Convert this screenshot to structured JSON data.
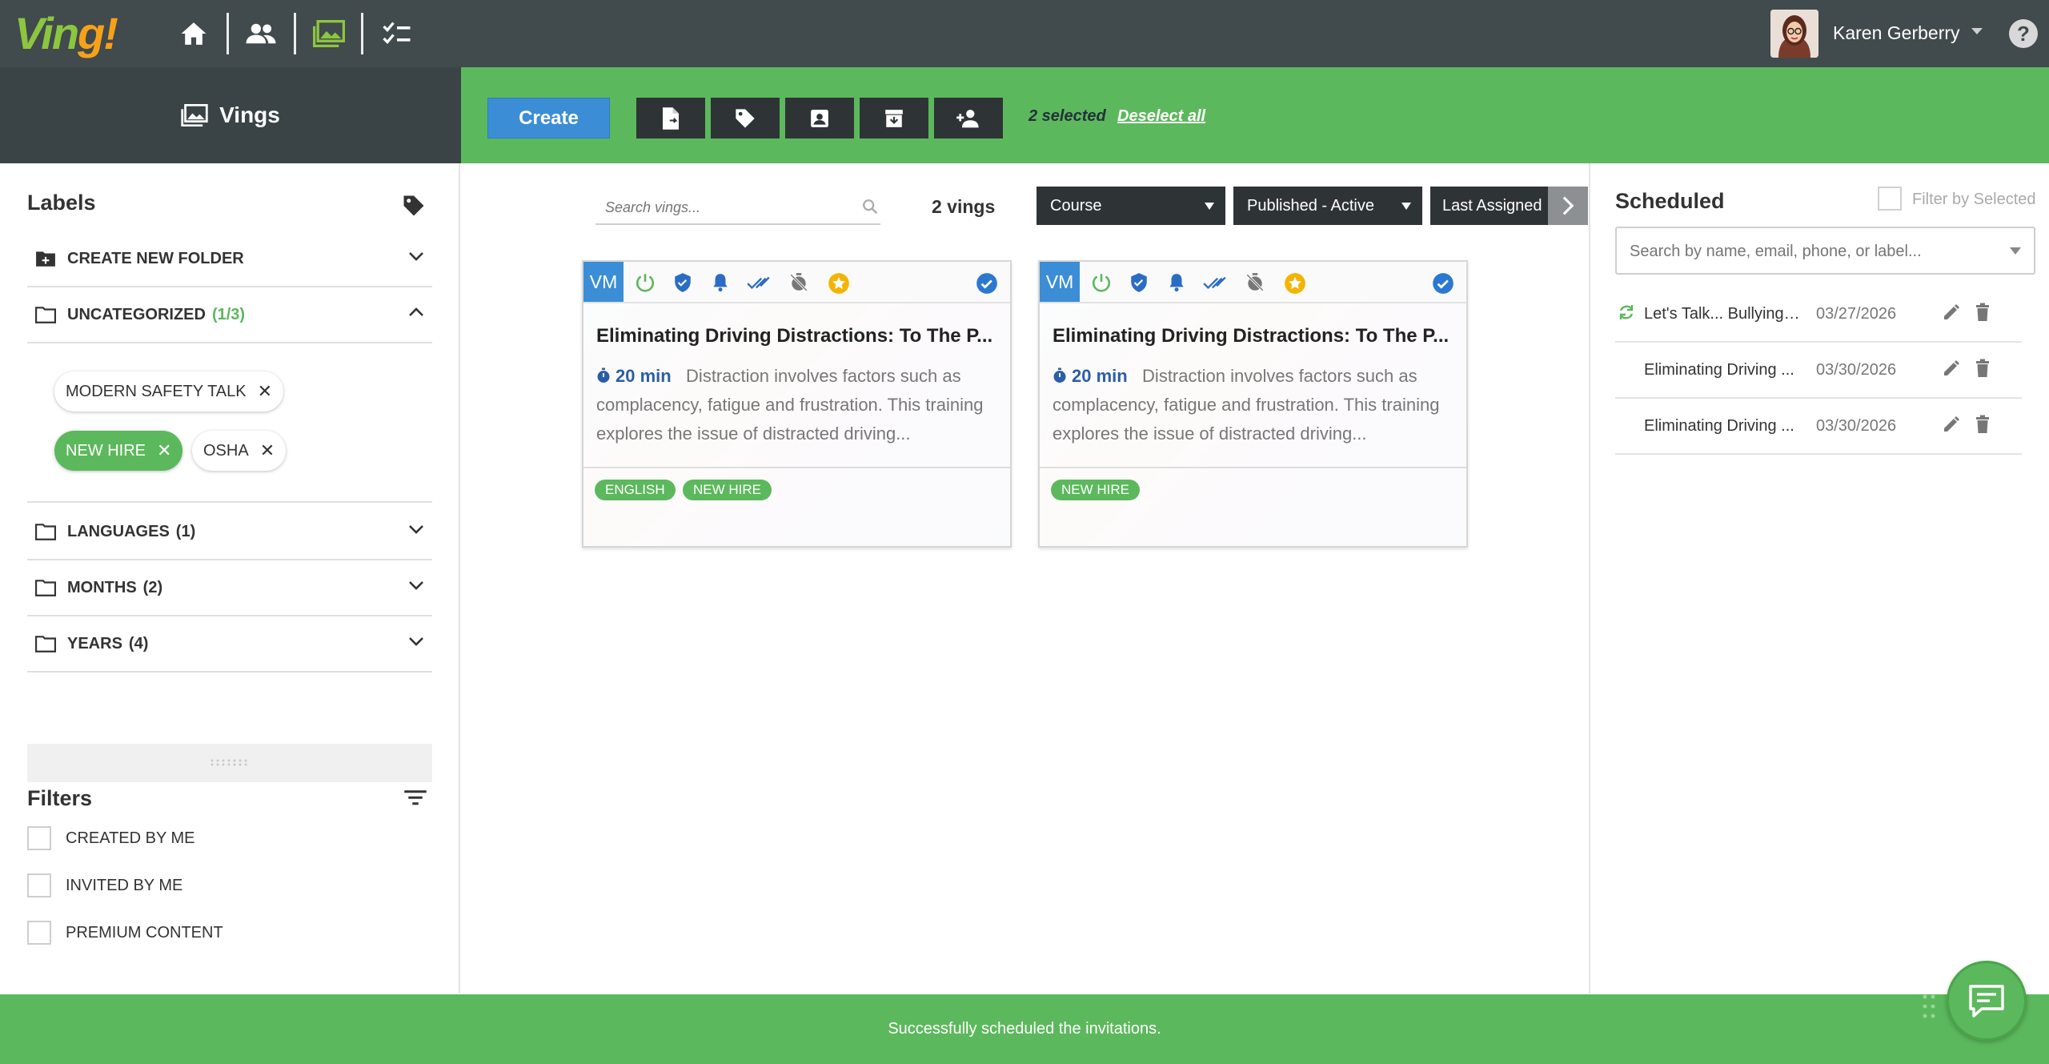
{
  "app": {
    "logo": "Ving!",
    "user_name": "Karen Gerberry",
    "help_symbol": "?",
    "nav_icons": [
      "home-icon",
      "people-icon",
      "vings-gallery-icon",
      "checklist-icon"
    ]
  },
  "colors": {
    "brand_green": "#5cb85c",
    "logo_green": "#8cc63f",
    "logo_orange": "#f7a11a",
    "nav_dark": "#414a4c",
    "accent_blue": "#3b8ed6"
  },
  "toolbar": {
    "section_title": "Vings",
    "create_label": "Create",
    "action_icons": [
      "document-export-icon",
      "tag-icon",
      "contact-card-icon",
      "archive-icon",
      "add-person-icon"
    ],
    "selected_text": "2 selected",
    "deselect_label": "Deselect all"
  },
  "labels_panel": {
    "title": "Labels",
    "folders": [
      {
        "name": "CREATE NEW FOLDER",
        "count": ""
      },
      {
        "name": "UNCATEGORIZED",
        "count": "(1/3)"
      },
      {
        "name": "LANGUAGES",
        "count": "(1)"
      },
      {
        "name": "MONTHS",
        "count": "(2)"
      },
      {
        "name": "YEARS",
        "count": "(4)"
      }
    ],
    "chips": [
      {
        "label": "MODERN SAFETY TALK",
        "selected": false
      },
      {
        "label": "NEW HIRE",
        "selected": true
      },
      {
        "label": "OSHA",
        "selected": false
      }
    ]
  },
  "filters_panel": {
    "title": "Filters",
    "items": [
      {
        "label": "CREATED BY ME",
        "checked": false
      },
      {
        "label": "INVITED BY ME",
        "checked": false
      },
      {
        "label": "PREMIUM CONTENT",
        "checked": false
      }
    ]
  },
  "search": {
    "placeholder": "Search vings...",
    "count_text": "2 vings",
    "dropdowns": [
      "Course",
      "Published - Active",
      "Last Assigned"
    ]
  },
  "cards": [
    {
      "badge": "VM",
      "title": "Eliminating Driving Distractions: To The P...",
      "duration": "20 min",
      "description": "Distraction involves factors such as complacency, fatigue and frustration. This training explores the issue of distracted driving...",
      "tags": [
        "ENGLISH",
        "NEW HIRE"
      ],
      "selected": true
    },
    {
      "badge": "VM",
      "title": "Eliminating Driving Distractions: To The P...",
      "duration": "20 min",
      "description": "Distraction involves factors such as complacency, fatigue and frustration. This training explores the issue of distracted driving...",
      "tags": [
        "NEW HIRE"
      ],
      "selected": true
    }
  ],
  "scheduled": {
    "title": "Scheduled",
    "filter_label": "Filter by Selected",
    "search_placeholder": "Search by name, email, phone, or label...",
    "rows": [
      {
        "name": "Let's Talk... Bullying, ...",
        "date": "03/27/2026",
        "recurring": true
      },
      {
        "name": "Eliminating Driving ...",
        "date": "03/30/2026",
        "recurring": false
      },
      {
        "name": "Eliminating Driving ...",
        "date": "03/30/2026",
        "recurring": false
      }
    ]
  },
  "footer": {
    "message": "Successfully scheduled the invitations."
  }
}
